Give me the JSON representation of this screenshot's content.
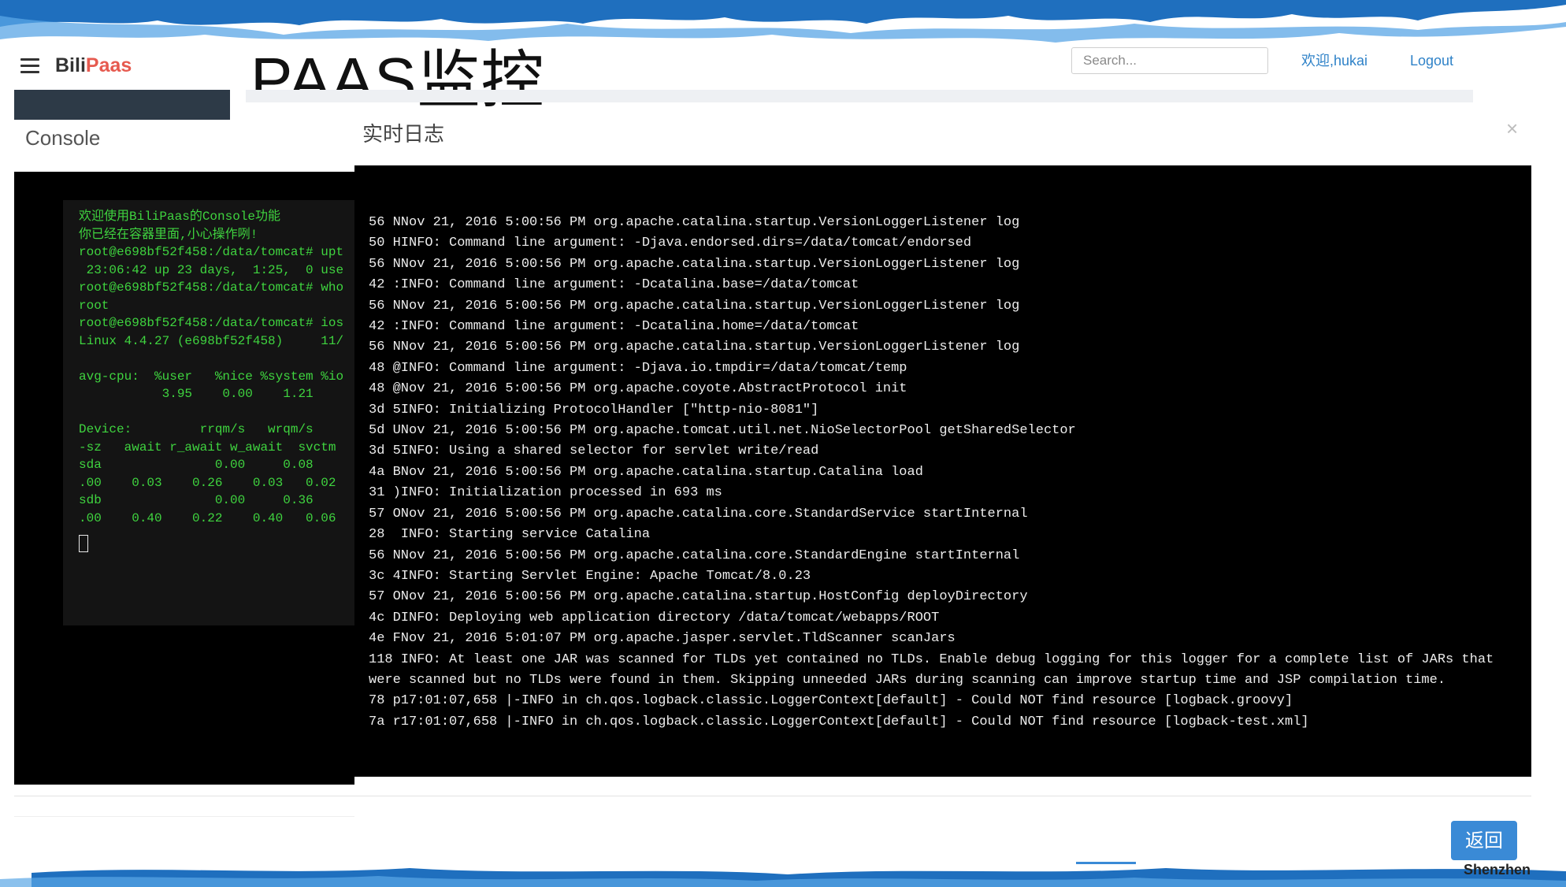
{
  "header": {
    "brand_part1": "Bili",
    "brand_part2": "Paas",
    "slide_title": "PAAS监控",
    "search_placeholder": "Search...",
    "welcome": "欢迎,hukai",
    "logout": "Logout"
  },
  "colors": {
    "brand_accent": "#e65a4f",
    "link": "#2f82c8",
    "button": "#3a8ad6",
    "terminal_text": "#3fd43f",
    "log_text": "#ececec"
  },
  "console": {
    "title": "Console",
    "lines": [
      "欢迎使用BiliPaas的Console功能",
      "你已经在容器里面,小心操作咧!",
      "root@e698bf52f458:/data/tomcat# upt",
      " 23:06:42 up 23 days,  1:25,  0 use",
      "root@e698bf52f458:/data/tomcat# who",
      "root",
      "root@e698bf52f458:/data/tomcat# ios",
      "Linux 4.4.27 (e698bf52f458)     11/",
      "",
      "avg-cpu:  %user   %nice %system %io",
      "           3.95    0.00    1.21",
      "",
      "Device:         rrqm/s   wrqm/s",
      "-sz   await r_await w_await  svctm",
      "sda               0.00     0.08",
      ".00    0.03    0.26    0.03   0.02",
      "sdb               0.00     0.36",
      ".00    0.40    0.22    0.40   0.06"
    ]
  },
  "log": {
    "title": "实时日志",
    "lines": [
      "56 NNov 21, 2016 5:00:56 PM org.apache.catalina.startup.VersionLoggerListener log",
      "50 HINFO: Command line argument: -Djava.endorsed.dirs=/data/tomcat/endorsed",
      "56 NNov 21, 2016 5:00:56 PM org.apache.catalina.startup.VersionLoggerListener log",
      "42 :INFO: Command line argument: -Dcatalina.base=/data/tomcat",
      "56 NNov 21, 2016 5:00:56 PM org.apache.catalina.startup.VersionLoggerListener log",
      "42 :INFO: Command line argument: -Dcatalina.home=/data/tomcat",
      "56 NNov 21, 2016 5:00:56 PM org.apache.catalina.startup.VersionLoggerListener log",
      "48 @INFO: Command line argument: -Djava.io.tmpdir=/data/tomcat/temp",
      "48 @Nov 21, 2016 5:00:56 PM org.apache.coyote.AbstractProtocol init",
      "3d 5INFO: Initializing ProtocolHandler [\"http-nio-8081\"]",
      "5d UNov 21, 2016 5:00:56 PM org.apache.tomcat.util.net.NioSelectorPool getSharedSelector",
      "3d 5INFO: Using a shared selector for servlet write/read",
      "4a BNov 21, 2016 5:00:56 PM org.apache.catalina.startup.Catalina load",
      "31 )INFO: Initialization processed in 693 ms",
      "57 ONov 21, 2016 5:00:56 PM org.apache.catalina.core.StandardService startInternal",
      "28  INFO: Starting service Catalina",
      "56 NNov 21, 2016 5:00:56 PM org.apache.catalina.core.StandardEngine startInternal",
      "3c 4INFO: Starting Servlet Engine: Apache Tomcat/8.0.23",
      "57 ONov 21, 2016 5:00:56 PM org.apache.catalina.startup.HostConfig deployDirectory",
      "4c DINFO: Deploying web application directory /data/tomcat/webapps/ROOT",
      "4e FNov 21, 2016 5:01:07 PM org.apache.jasper.servlet.TldScanner scanJars",
      "118 INFO: At least one JAR was scanned for TLDs yet contained no TLDs. Enable debug logging for this logger for a complete list of JARs that were scanned but no TLDs were found in them. Skipping unneeded JARs during scanning can improve startup time and JSP compilation time.",
      "78 p17:01:07,658 |-INFO in ch.qos.logback.classic.LoggerContext[default] - Could NOT find resource [logback.groovy]",
      "7a r17:01:07,658 |-INFO in ch.qos.logback.classic.LoggerContext[default] - Could NOT find resource [logback-test.xml]"
    ]
  },
  "footer": {
    "back_button": "返回",
    "watermark": "Shenzhen"
  }
}
